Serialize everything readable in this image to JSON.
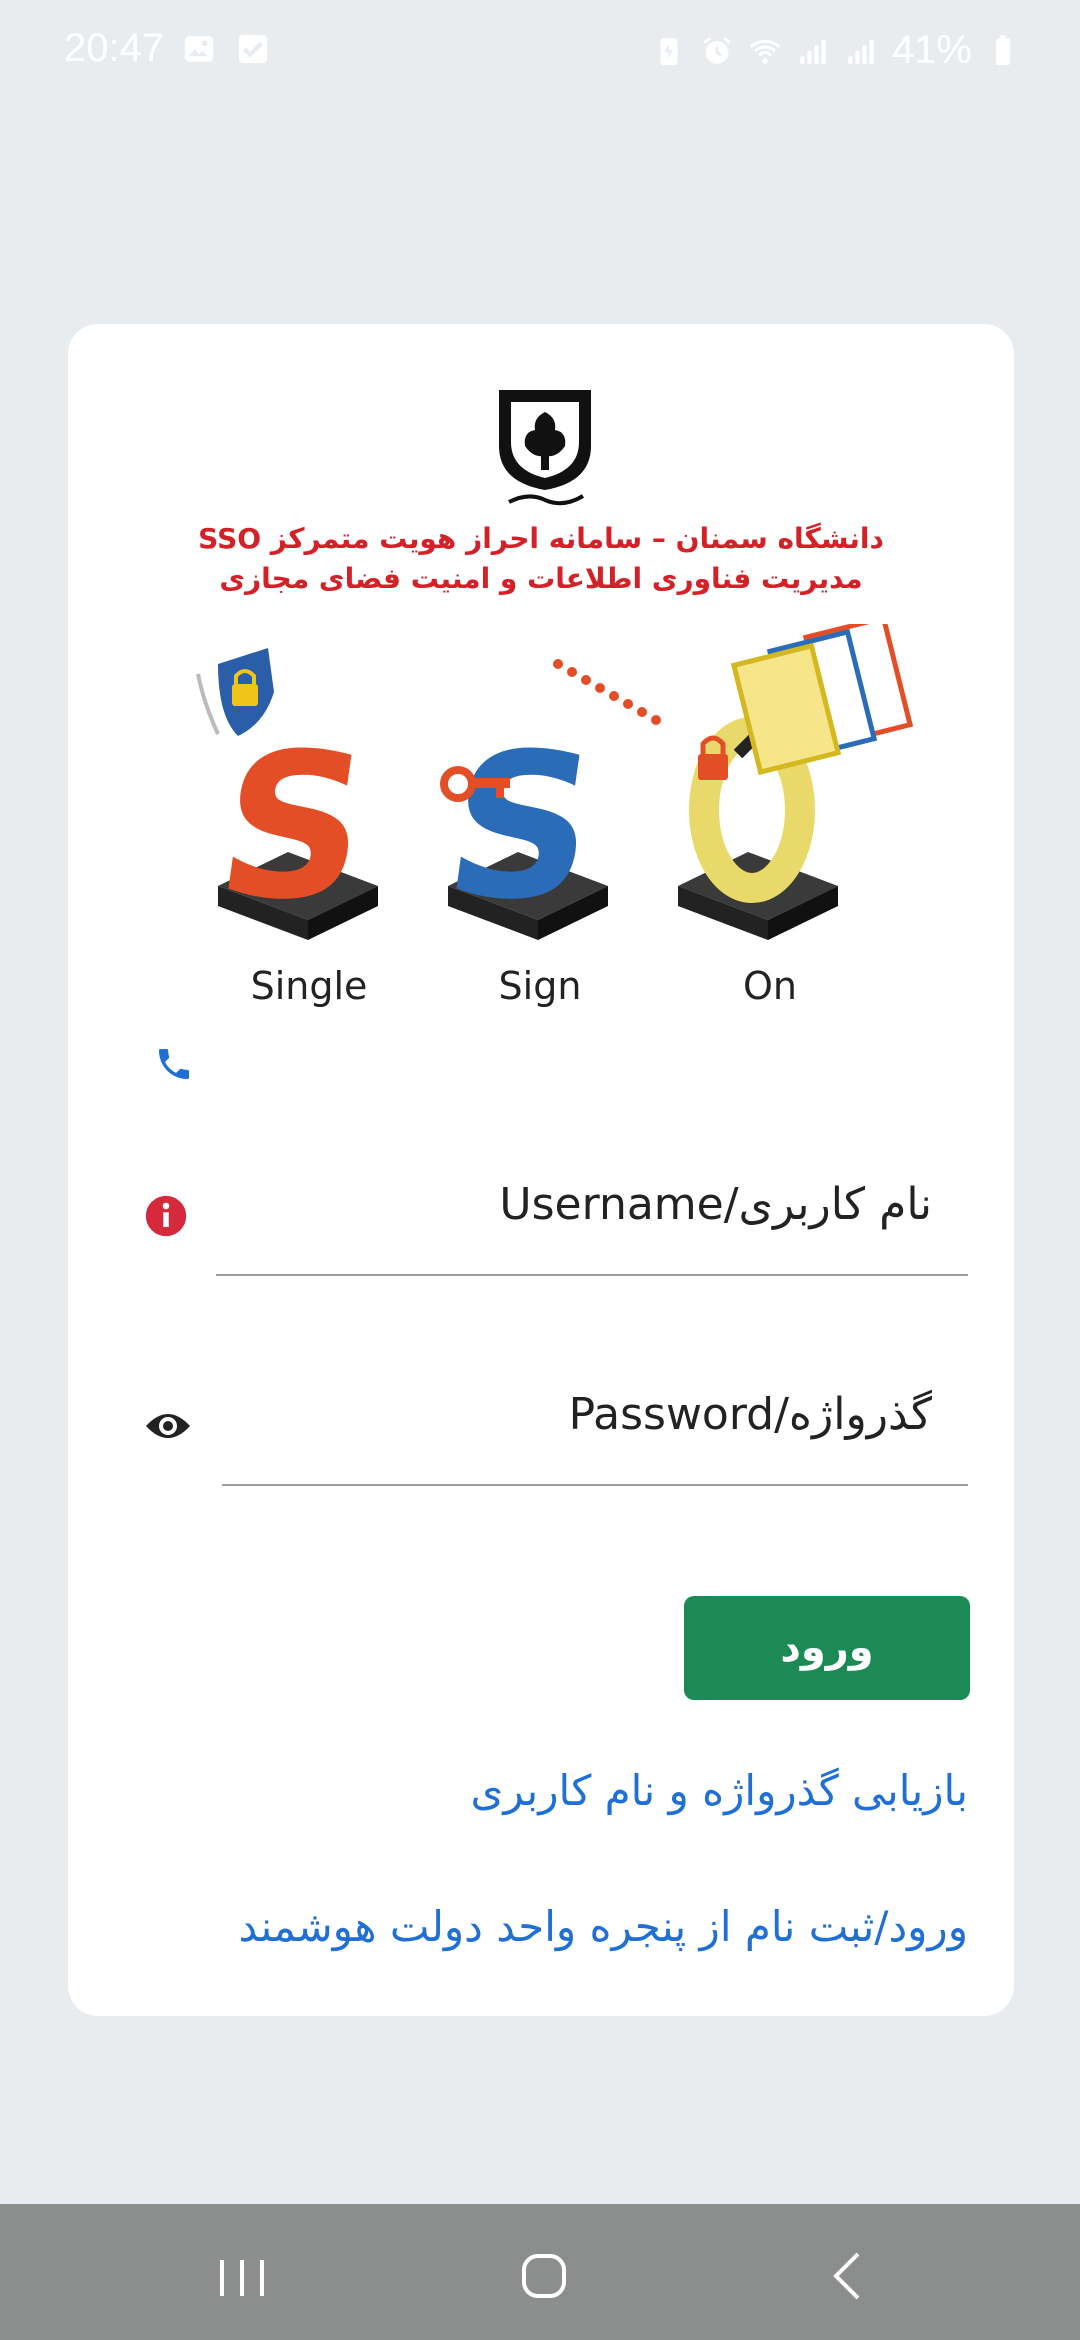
{
  "status_bar": {
    "time": "20:47",
    "battery": "41%",
    "icons": [
      "image-icon",
      "check-box-icon",
      "battery-saver-icon",
      "alarm-icon",
      "wifi-icon",
      "signal-icon",
      "signal-icon",
      "battery-icon"
    ]
  },
  "card": {
    "header_line1": "دانشگاه سمنان – سامانه احراز هویت متمرکز SSO",
    "header_line2": "مدیریت فناوری اطلاعات و امنیت فضای مجازی",
    "logo_text": "دانشگاه سمنان",
    "sso_labels": [
      "Single",
      "Sign",
      "On"
    ],
    "contact_icon": "phone-icon",
    "username_placeholder": "نام کاربری/Username",
    "password_placeholder": "گذرواژه/Password",
    "login_button": "ورود",
    "recover_link": "بازیابی گذرواژه و نام کاربری",
    "sso_link": "ورود/ثبت نام از پنجره واحد دولت هوشمند"
  },
  "colors": {
    "background": "#e9ecef",
    "card": "#ffffff",
    "header_red": "#d42027",
    "button_green": "#1c8a55",
    "link_blue": "#1f6fd6",
    "navbar": "#8c8e8d"
  },
  "nav_bar": {
    "buttons": [
      "recents-icon",
      "home-icon",
      "back-icon"
    ]
  }
}
